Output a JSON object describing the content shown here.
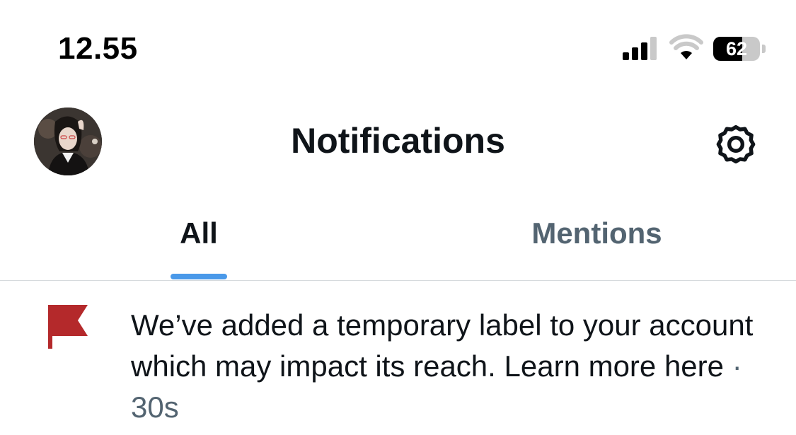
{
  "status_bar": {
    "time": "12.55",
    "battery_level": "62",
    "battery_fraction": 0.62,
    "signal_bars": 3,
    "signal_icon": "cellular-signal-icon",
    "wifi_icon": "wifi-icon",
    "battery_icon": "battery-icon"
  },
  "header": {
    "title": "Notifications",
    "avatar_icon": "profile-avatar",
    "settings_icon": "gear-icon"
  },
  "tabs": [
    {
      "label": "All",
      "active": true
    },
    {
      "label": "Mentions",
      "active": false
    }
  ],
  "notifications": [
    {
      "icon": "flag-icon",
      "icon_color": "#b4292b",
      "text": "We’ve added a temporary label to your account which may impact its reach. Learn more here",
      "separator": "·",
      "time": "30s"
    }
  ],
  "colors": {
    "accent": "#4a99e9",
    "primary_text": "#0f1419",
    "secondary_text": "#536471",
    "divider": "#d6dadd",
    "flag": "#b4292b"
  }
}
